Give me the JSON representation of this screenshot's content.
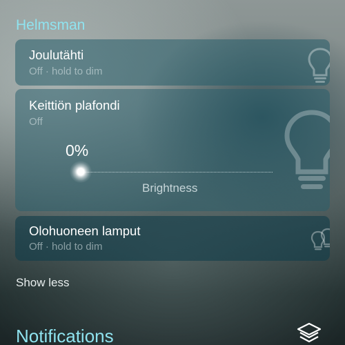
{
  "group": {
    "title": "Helmsman"
  },
  "devices": [
    {
      "name": "Joulutähti",
      "status": "Off · hold to dim",
      "icon": "lightbulb-icon"
    },
    {
      "name": "Keittiön plafondi",
      "status": "Off",
      "icon": "lightbulb-icon",
      "brightness_percent": "0%",
      "brightness_value": 0,
      "slider_label": "Brightness"
    },
    {
      "name": "Olohuoneen lamput",
      "status": "Off · hold to dim",
      "icon": "multi-bulb-icon"
    }
  ],
  "show_less_label": "Show less",
  "notifications_label": "Notifications",
  "colors": {
    "accent": "#8fe3ef",
    "card": "#265c6a",
    "text": "#ffffff"
  }
}
